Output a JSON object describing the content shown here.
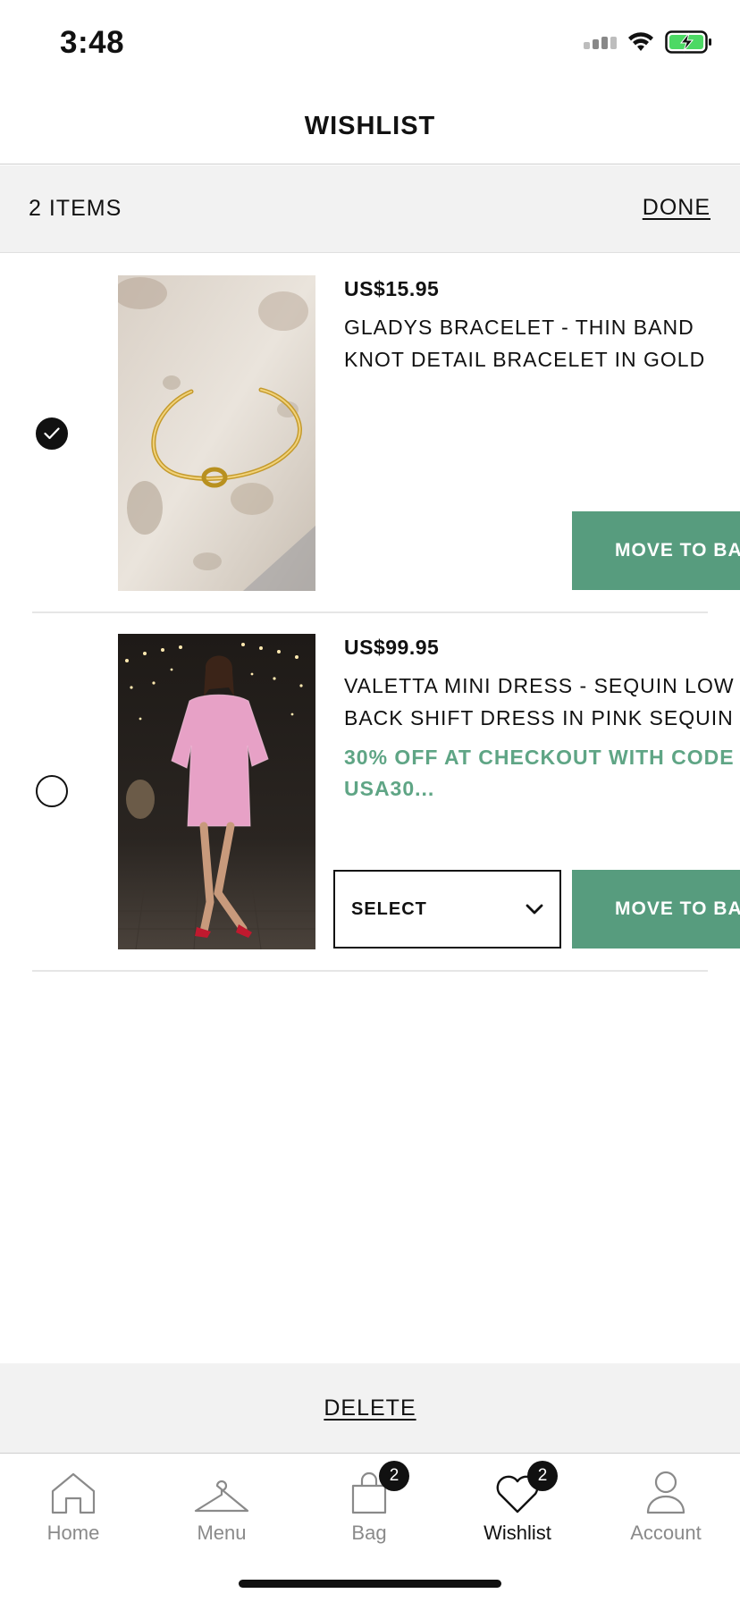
{
  "status_bar": {
    "time": "3:48"
  },
  "header": {
    "title": "WISHLIST"
  },
  "items_bar": {
    "count": "2 ITEMS",
    "done_label": "DONE"
  },
  "products": [
    {
      "price": "US$15.95",
      "name_line1": "GLADYS BRACELET - THIN BAND",
      "name_line2": "KNOT DETAIL BRACELET IN GOLD",
      "selected": true,
      "move_label": "MOVE TO BAG"
    },
    {
      "price": "US$99.95",
      "name_line1": "VALETTA MINI DRESS - SEQUIN LOW",
      "name_line2": "BACK SHIFT DRESS IN PINK SEQUIN",
      "promo_line1": "30% OFF AT CHECKOUT WITH CODE",
      "promo_line2": "USA30...",
      "selected": false,
      "select_label": "SELECT",
      "move_label": "MOVE TO BAG"
    }
  ],
  "footer": {
    "delete_label": "DELETE"
  },
  "tabs": [
    {
      "label": "Home",
      "icon": "home-icon"
    },
    {
      "label": "Menu",
      "icon": "hanger-icon"
    },
    {
      "label": "Bag",
      "icon": "bag-icon",
      "badge": "2"
    },
    {
      "label": "Wishlist",
      "icon": "heart-icon",
      "badge": "2",
      "active": true
    },
    {
      "label": "Account",
      "icon": "person-icon"
    }
  ],
  "colors": {
    "accent_green": "#579c7e",
    "promo_green": "#5fa585",
    "battery_green": "#4cd964"
  }
}
